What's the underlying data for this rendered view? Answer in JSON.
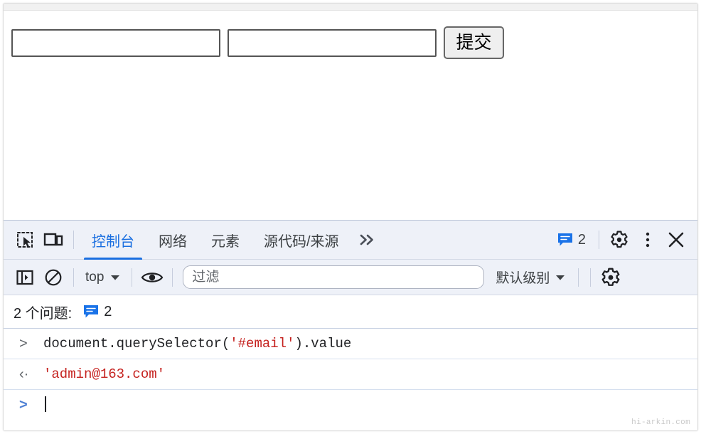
{
  "page": {
    "field_1": {
      "value": "",
      "placeholder": ""
    },
    "field_2": {
      "value": "",
      "placeholder": ""
    },
    "submit_label": "提交"
  },
  "devtools": {
    "tabbar": {
      "inspect_icon": "inspect-element-icon",
      "device_icon": "device-toolbar-icon",
      "tabs": [
        {
          "label": "控制台",
          "active": true
        },
        {
          "label": "网络",
          "active": false
        },
        {
          "label": "元素",
          "active": false
        },
        {
          "label": "源代码/来源",
          "active": false
        }
      ],
      "overflow_label": "»",
      "issues_count": "2",
      "settings_icon": "gear-icon",
      "more_icon": "kebab-menu-icon",
      "close_icon": "close-icon"
    },
    "console_toolbar": {
      "sidebar_icon": "console-sidebar-icon",
      "clear_icon": "clear-console-icon",
      "context": "top",
      "eye_icon": "live-expression-icon",
      "filter_placeholder": "过滤",
      "filter_value": "",
      "level": "默认级别",
      "settings_icon": "gear-icon"
    },
    "issues_bar": {
      "label": "2 个问题:",
      "count": "2"
    },
    "console": {
      "lines": [
        {
          "type": "input",
          "marker": ">",
          "code_pre": "document.querySelector(",
          "code_str": "'#email'",
          "code_post": ").value"
        },
        {
          "type": "output",
          "marker": "‹·",
          "result": "'admin@163.com'"
        },
        {
          "type": "prompt",
          "marker": ">",
          "value": ""
        }
      ]
    }
  },
  "watermark": "hi-arkin.com",
  "colors": {
    "accent_blue": "#1a6fe0",
    "string_red": "#c5221f",
    "toolbar_bg": "#eef1f8",
    "issue_blue": "#1a73e8"
  }
}
